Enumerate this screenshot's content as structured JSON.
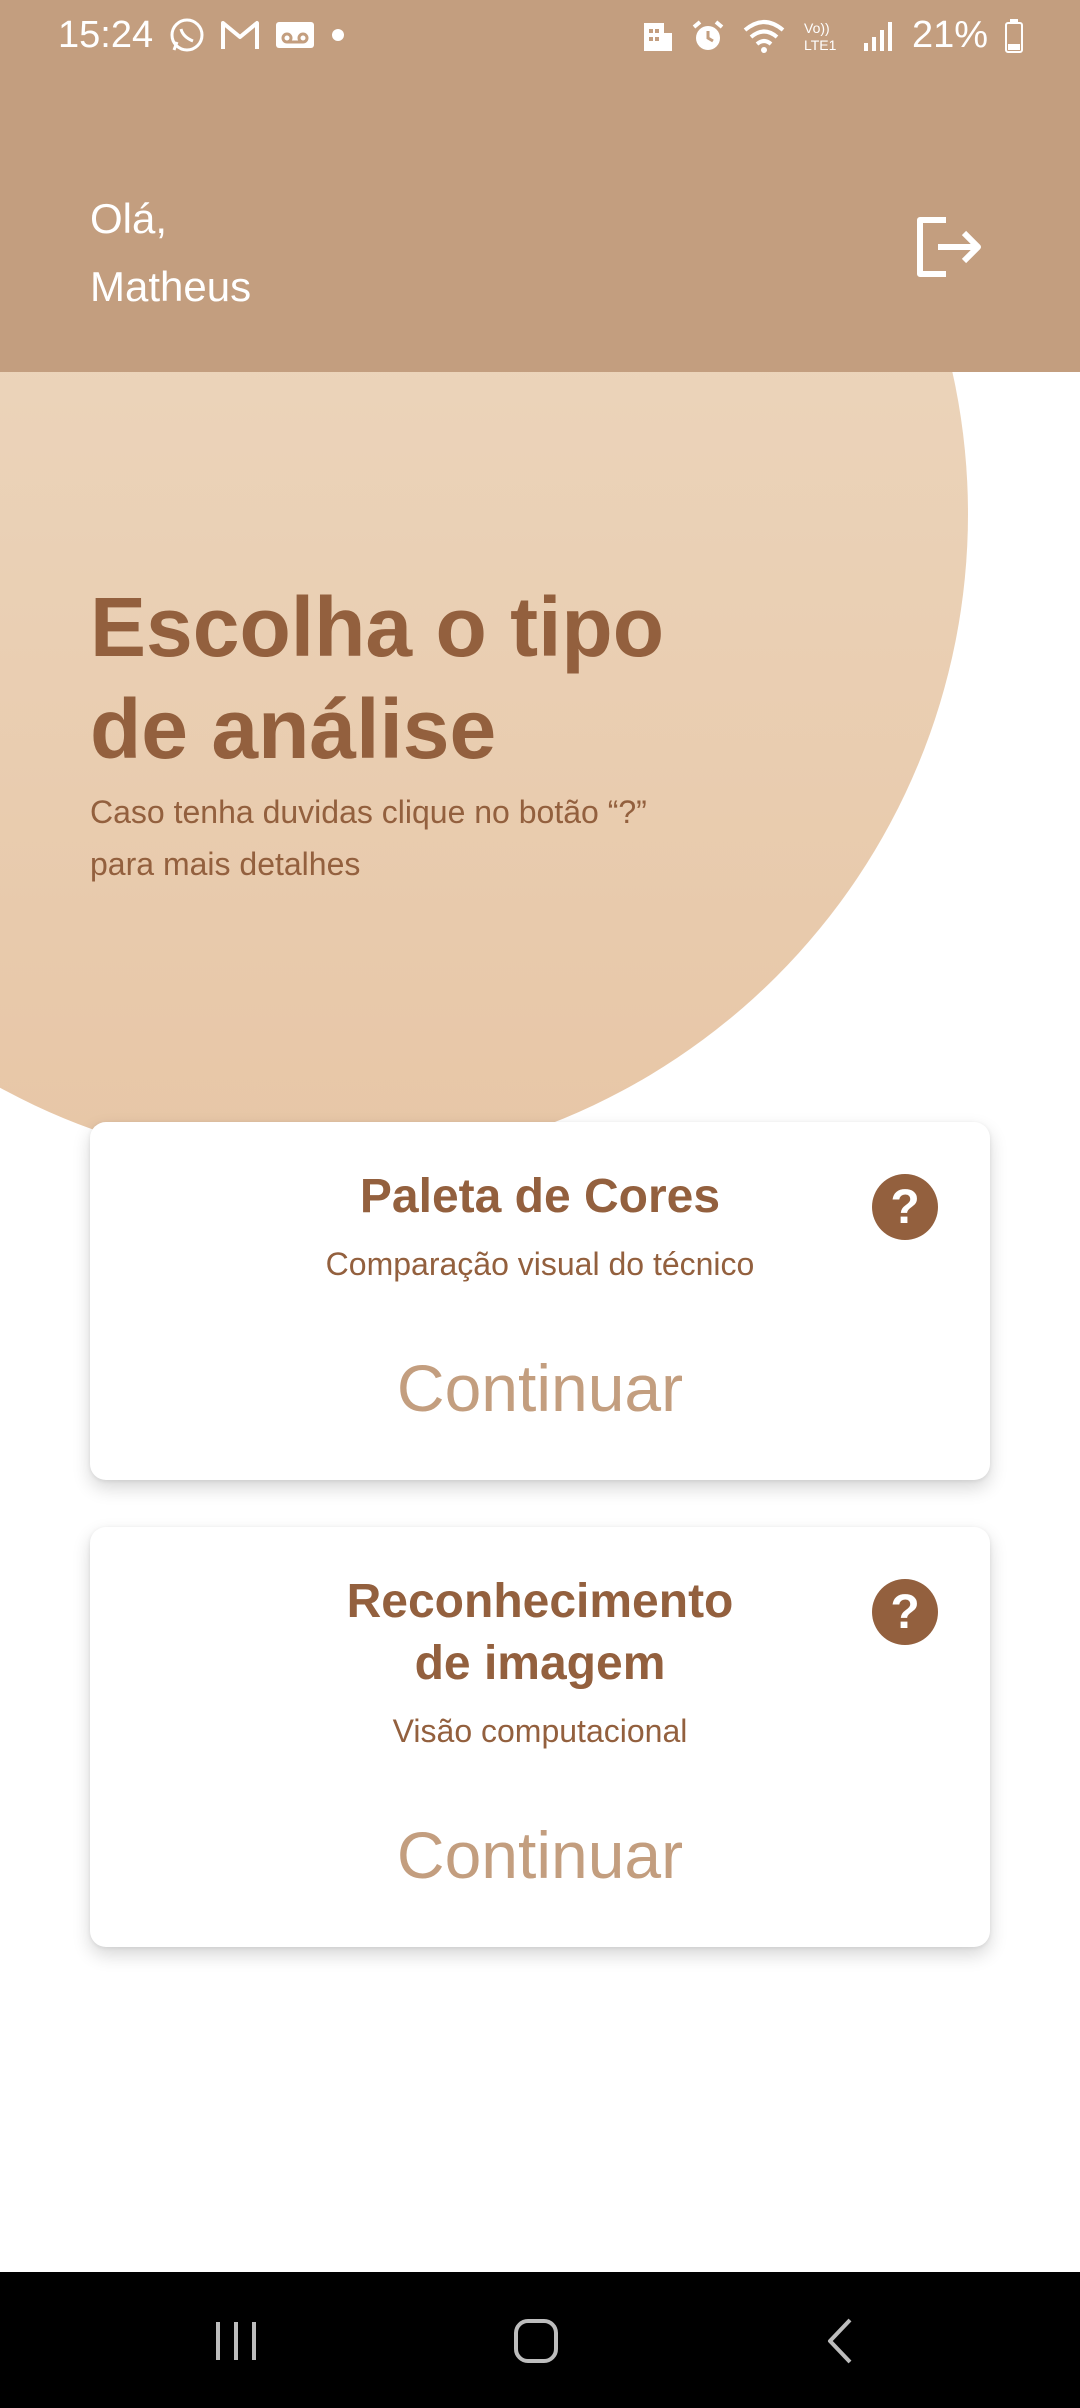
{
  "status_bar": {
    "time": "15:24",
    "battery": "21%",
    "icons_left": [
      "whatsapp-icon",
      "gmail-icon",
      "voicemail-icon",
      "dot-icon"
    ],
    "icons_right": [
      "building-icon",
      "alarm-icon",
      "wifi-icon",
      "volte-icon",
      "signal-icon",
      "battery-icon"
    ],
    "volte_text": "Vo)) LTE1"
  },
  "header": {
    "greeting_line1": "Olá,",
    "greeting_line2": "Matheus",
    "logout_icon": "logout-icon",
    "background_color": "#c39e7f"
  },
  "hero": {
    "title_line1": "Escolha o tipo",
    "title_line2": "de análise",
    "subtitle_line1": "Caso tenha duvidas clique no botão “?”",
    "subtitle_line2": "para mais detalhes",
    "gradient": [
      "#eedcc6",
      "#e7c6a6"
    ]
  },
  "cards": [
    {
      "title_line1": "Paleta de Cores",
      "title_line2": "",
      "description": "Comparação visual do técnico",
      "help_label": "?",
      "continue_label": "Continuar"
    },
    {
      "title_line1": "Reconhecimento",
      "title_line2": "de imagem",
      "description": "Visão computacional",
      "help_label": "?",
      "continue_label": "Continuar"
    }
  ],
  "colors": {
    "brand_brown": "#93603e",
    "accent_tan": "#c39e7f"
  },
  "nav_bar": {
    "buttons": [
      "recents-icon",
      "home-icon",
      "back-icon"
    ]
  }
}
